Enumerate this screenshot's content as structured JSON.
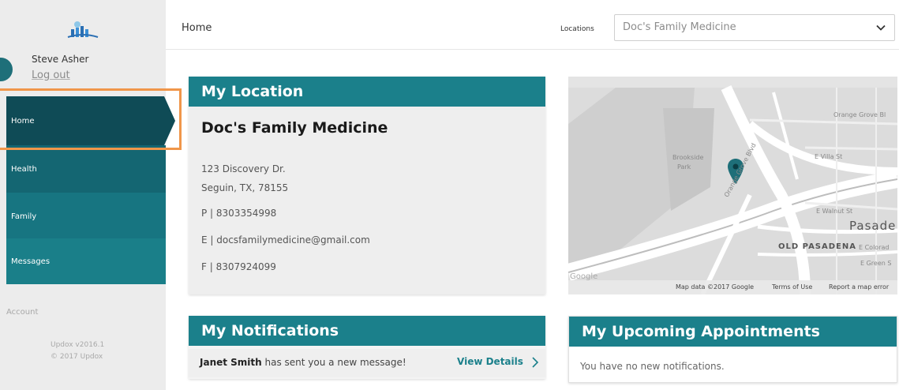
{
  "sidebar": {
    "user_name": "Steve Asher",
    "logout_label": "Log out",
    "nav": {
      "home": "Home",
      "health": "Health",
      "family": "Family",
      "messages": "Messages"
    },
    "account_label": "Account",
    "version": "Updox v2016.1",
    "copyright": "© 2017 Updox"
  },
  "header": {
    "title": "Home",
    "locations_label": "Locations",
    "location_selected": "Doc's Family Medicine"
  },
  "my_location": {
    "title": "My Location",
    "name": "Doc's Family Medicine",
    "address_line1": "123 Discovery Dr.",
    "address_line2": "Seguin, TX, 78155",
    "phone": "P | 8303354998",
    "email": "E | docsfamilymedicine@gmail.com",
    "fax": "F | 8307924099"
  },
  "map": {
    "labels": {
      "orange_grove": "Orange Grove Bl",
      "villa": "E Villa St",
      "brookside": "Brookside",
      "park": "Park",
      "walnut": "E Walnut St",
      "pasadena": "Pasade",
      "old_pasadena": "OLD PASADENA",
      "colorado": "E Colorad",
      "green": "E Green S",
      "orange_grove_road": "Orange Grove Blvd",
      "google": "Google"
    },
    "attribution": "Map data ©2017 Google",
    "terms": "Terms of Use",
    "report": "Report a map error"
  },
  "notifications": {
    "title": "My Notifications",
    "sender": "Janet Smith",
    "message": " has sent you a new message!",
    "view_details": "View Details"
  },
  "appointments": {
    "title": "My Upcoming Appointments",
    "empty_text": "You have no new notifications."
  },
  "colors": {
    "teal": "#1b808b",
    "nav_active": "#0f4b56",
    "highlight": "#f0964a",
    "map_pin": "#1e6f79"
  }
}
